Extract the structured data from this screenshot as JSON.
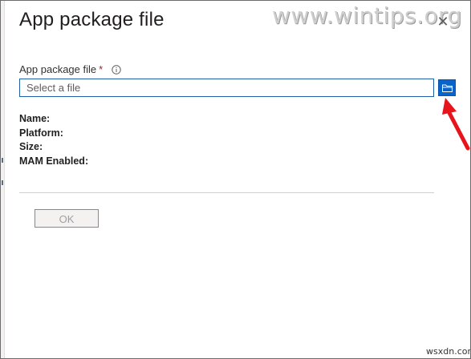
{
  "dialog": {
    "title": "App package file",
    "close_glyph": "✕"
  },
  "watermark": {
    "text": "www.wintips.org"
  },
  "field": {
    "label": "App package file",
    "required_mark": "*",
    "placeholder": "Select a file",
    "value": "",
    "info_icon": "info-icon",
    "browse_icon": "folder-icon"
  },
  "details": {
    "name_label": "Name:",
    "platform_label": "Platform:",
    "size_label": "Size:",
    "mam_label": "MAM Enabled:"
  },
  "footer": {
    "ok_label": "OK"
  },
  "attribution": {
    "text": "wsxdn.com"
  },
  "colors": {
    "accent": "#0a63c9",
    "required": "#a4262c",
    "annotation_arrow": "#e8141c"
  }
}
